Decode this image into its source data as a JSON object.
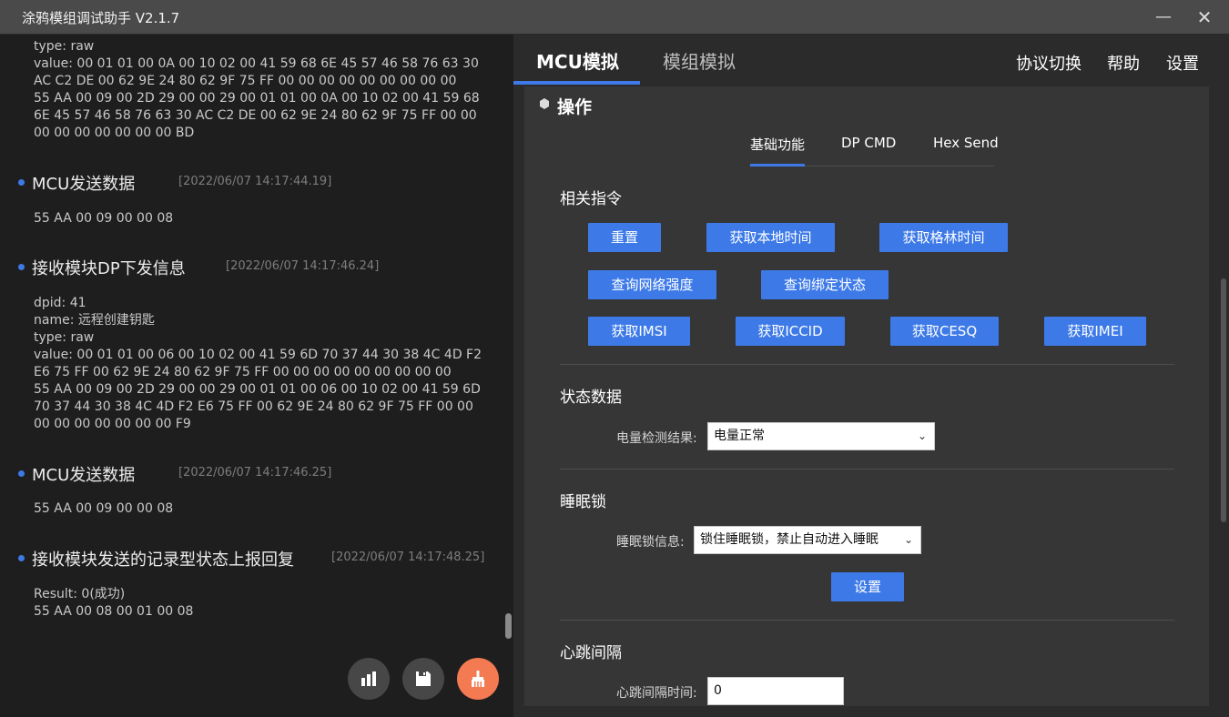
{
  "window": {
    "title": "涂鸦模组调试助手 V2.1.7",
    "minimize": "—",
    "close": "✕"
  },
  "log": {
    "partial_top": "type: raw\nvalue: 00 01 01 00 0A 00 10 02 00 41 59 68 6E 45 57 46 58 76 63 30\nAC C2 DE 00 62 9E 24 80 62 9F 75 FF 00 00 00 00 00 00 00 00 00\n55 AA 00 09 00 2D 29 00 00 29 00 01 01 00 0A 00 10 02 00 41 59 68\n6E 45 57 46 58 76 63 30 AC C2 DE 00 62 9E 24 80 62 9F 75 FF 00 00\n00 00 00 00 00 00 00 BD",
    "entries": [
      {
        "name": "MCU发送数据",
        "time": "[2022/06/07 14:17:44.19]",
        "body": "55 AA 00 09 00 00 08"
      },
      {
        "name": "接收模块DP下发信息",
        "time": "[2022/06/07 14:17:46.24]",
        "body": "dpid: 41\nname: 远程创建钥匙\ntype: raw\nvalue: 00 01 01 00 06 00 10 02 00 41 59 6D 70 37 44 30 38 4C 4D F2\nE6 75 FF 00 62 9E 24 80 62 9F 75 FF 00 00 00 00 00 00 00 00 00\n55 AA 00 09 00 2D 29 00 00 29 00 01 01 00 06 00 10 02 00 41 59 6D\n70 37 44 30 38 4C 4D F2 E6 75 FF 00 62 9E 24 80 62 9F 75 FF 00 00\n00 00 00 00 00 00 00 F9"
      },
      {
        "name": "MCU发送数据",
        "time": "[2022/06/07 14:17:46.25]",
        "body": "55 AA 00 09 00 00 08"
      },
      {
        "name": "接收模块发送的记录型状态上报回复",
        "time": "[2022/06/07 14:17:48.25]",
        "body": "Result: 0(成功)\n55 AA 00 08 00 01 00 08"
      }
    ]
  },
  "tabs": {
    "mcu": "MCU模拟",
    "module": "模组模拟"
  },
  "top_links": {
    "protocol": "协议切换",
    "help": "帮助",
    "settings": "设置"
  },
  "section": {
    "title": "操作",
    "sub_tabs": [
      "基础功能",
      "DP CMD",
      "Hex Send"
    ]
  },
  "commands": {
    "title": "相关指令",
    "buttons": {
      "reset": "重置",
      "get_local_time": "获取本地时间",
      "get_gmt_time": "获取格林时间",
      "query_signal": "查询网络强度",
      "query_bind": "查询绑定状态",
      "get_imsi": "获取IMSI",
      "get_iccid": "获取ICCID",
      "get_cesq": "获取CESQ",
      "get_imei": "获取IMEI"
    }
  },
  "status": {
    "title": "状态数据",
    "battery_label": "电量检测结果:",
    "battery_value": "电量正常"
  },
  "sleep": {
    "title": "睡眠锁",
    "info_label": "睡眠锁信息:",
    "info_value": "锁住睡眠锁，禁止自动进入睡眠",
    "set_button": "设置"
  },
  "heartbeat": {
    "title": "心跳间隔",
    "label": "心跳间隔时间:",
    "value": "0"
  }
}
